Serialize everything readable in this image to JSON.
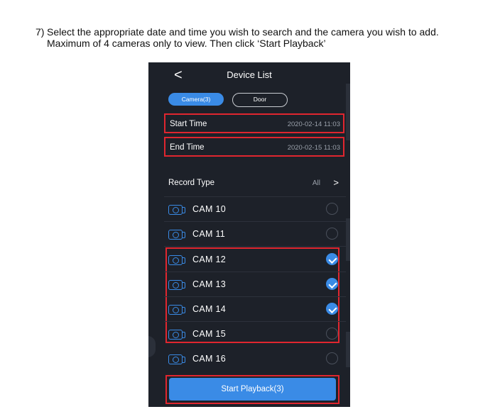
{
  "instruction": {
    "number": "7)",
    "line1": "Select the appropriate date and time you wish to search and the camera you wish to add.",
    "line2": "Maximum of 4 cameras only to view. Then click ‘Start Playback’"
  },
  "app": {
    "back_glyph": "<",
    "title": "Device List",
    "tabs": [
      {
        "label": "Camera(3)",
        "active": true
      },
      {
        "label": "Door",
        "active": false
      }
    ],
    "start_time": {
      "label": "Start Time",
      "value": "2020-02-14 11:03"
    },
    "end_time": {
      "label": "End Time",
      "value": "2020-02-15 11:03"
    },
    "record_type": {
      "label": "Record Type",
      "value": "All",
      "chevron": ">"
    },
    "cameras": [
      {
        "name": "CAM 10",
        "checked": false
      },
      {
        "name": "CAM 11",
        "checked": false
      },
      {
        "name": "CAM 12",
        "checked": true
      },
      {
        "name": "CAM 13",
        "checked": true
      },
      {
        "name": "CAM 14",
        "checked": true
      },
      {
        "name": "CAM 15",
        "checked": false
      },
      {
        "name": "CAM 16",
        "checked": false
      }
    ],
    "playback_button": "Start Playback(3)"
  },
  "colors": {
    "accent": "#3a8be6",
    "highlight": "#e0262f",
    "panel_bg": "#1d2129"
  },
  "icons": {
    "back": "chevron-left-icon",
    "camera": "camera-icon",
    "check": "check-circle-icon",
    "record_chevron": "chevron-right-icon"
  }
}
